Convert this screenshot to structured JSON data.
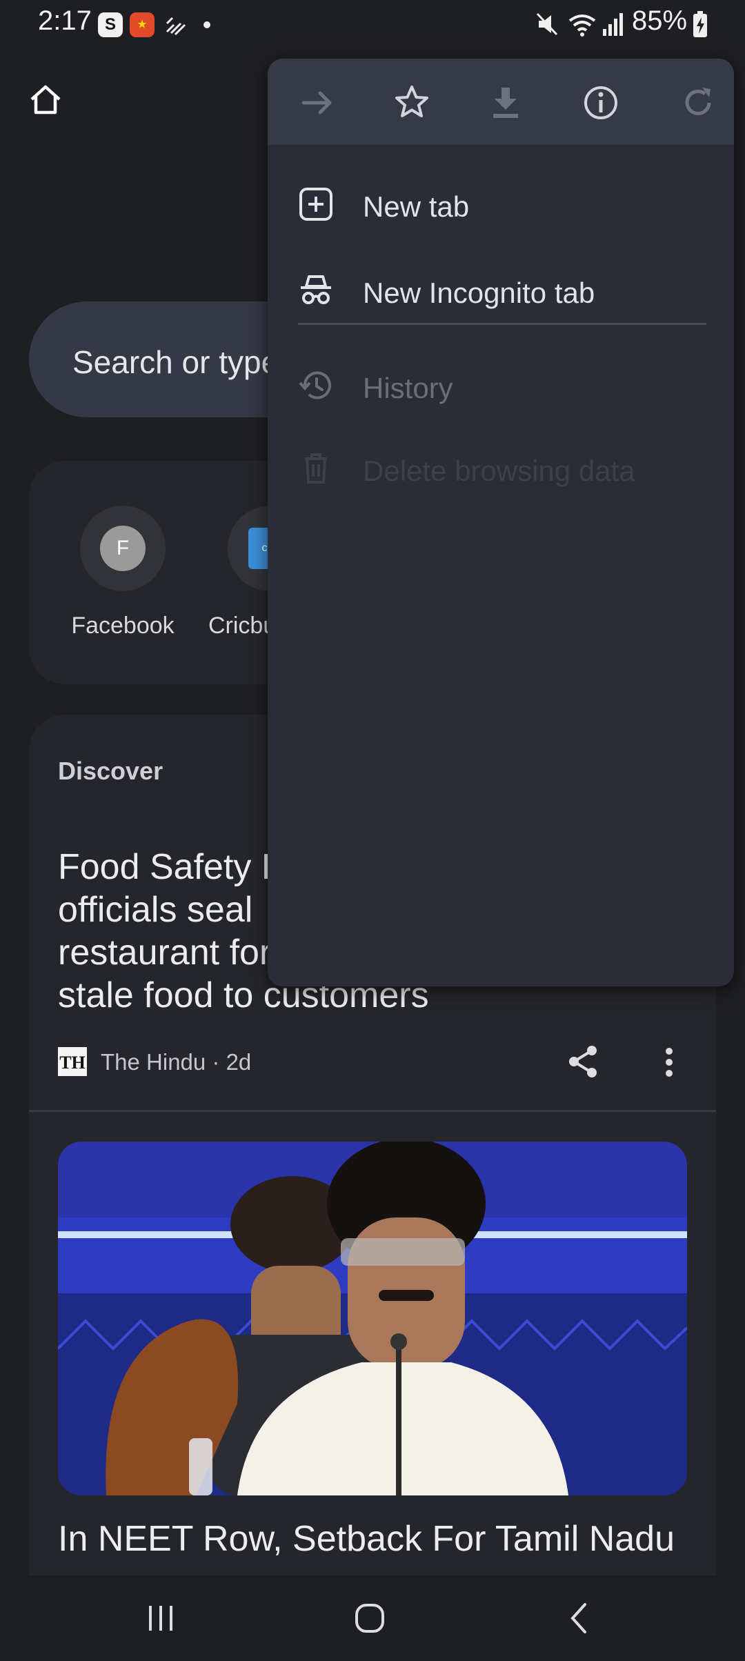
{
  "status_bar": {
    "time": "2:17",
    "battery": "85%"
  },
  "new_tab_page": {
    "search_placeholder": "Search or type",
    "shortcuts": [
      {
        "initial": "F",
        "label": "Facebook"
      },
      {
        "initial": "cric",
        "label": "Cricbu"
      }
    ],
    "discover": {
      "title": "Discover",
      "articles": [
        {
          "headline_lines": [
            "Food Safety D",
            "officials seal",
            "restaurant for",
            "stale food to customers"
          ],
          "source_logo": "TH",
          "source": "The Hindu · 2d"
        },
        {
          "headline": "In NEET Row, Setback For Tamil Nadu"
        }
      ]
    }
  },
  "menu": {
    "toolbar": [
      {
        "icon": "forward-icon",
        "enabled": false
      },
      {
        "icon": "star-icon",
        "enabled": true
      },
      {
        "icon": "download-icon",
        "enabled": false
      },
      {
        "icon": "info-icon",
        "enabled": true
      },
      {
        "icon": "refresh-icon",
        "enabled": false
      }
    ],
    "items": [
      {
        "label": "New tab",
        "icon": "add-box-icon"
      },
      {
        "label": "New Incognito tab",
        "icon": "incognito-icon"
      },
      {
        "label": "History",
        "icon": "history-icon"
      },
      {
        "label": "Delete browsing data",
        "icon": "trash-icon"
      }
    ]
  },
  "colors": {
    "background": "#1e1f22",
    "menu": "#2a2d38",
    "menu_toolbar": "#363a47",
    "search_pill": "#353845"
  }
}
